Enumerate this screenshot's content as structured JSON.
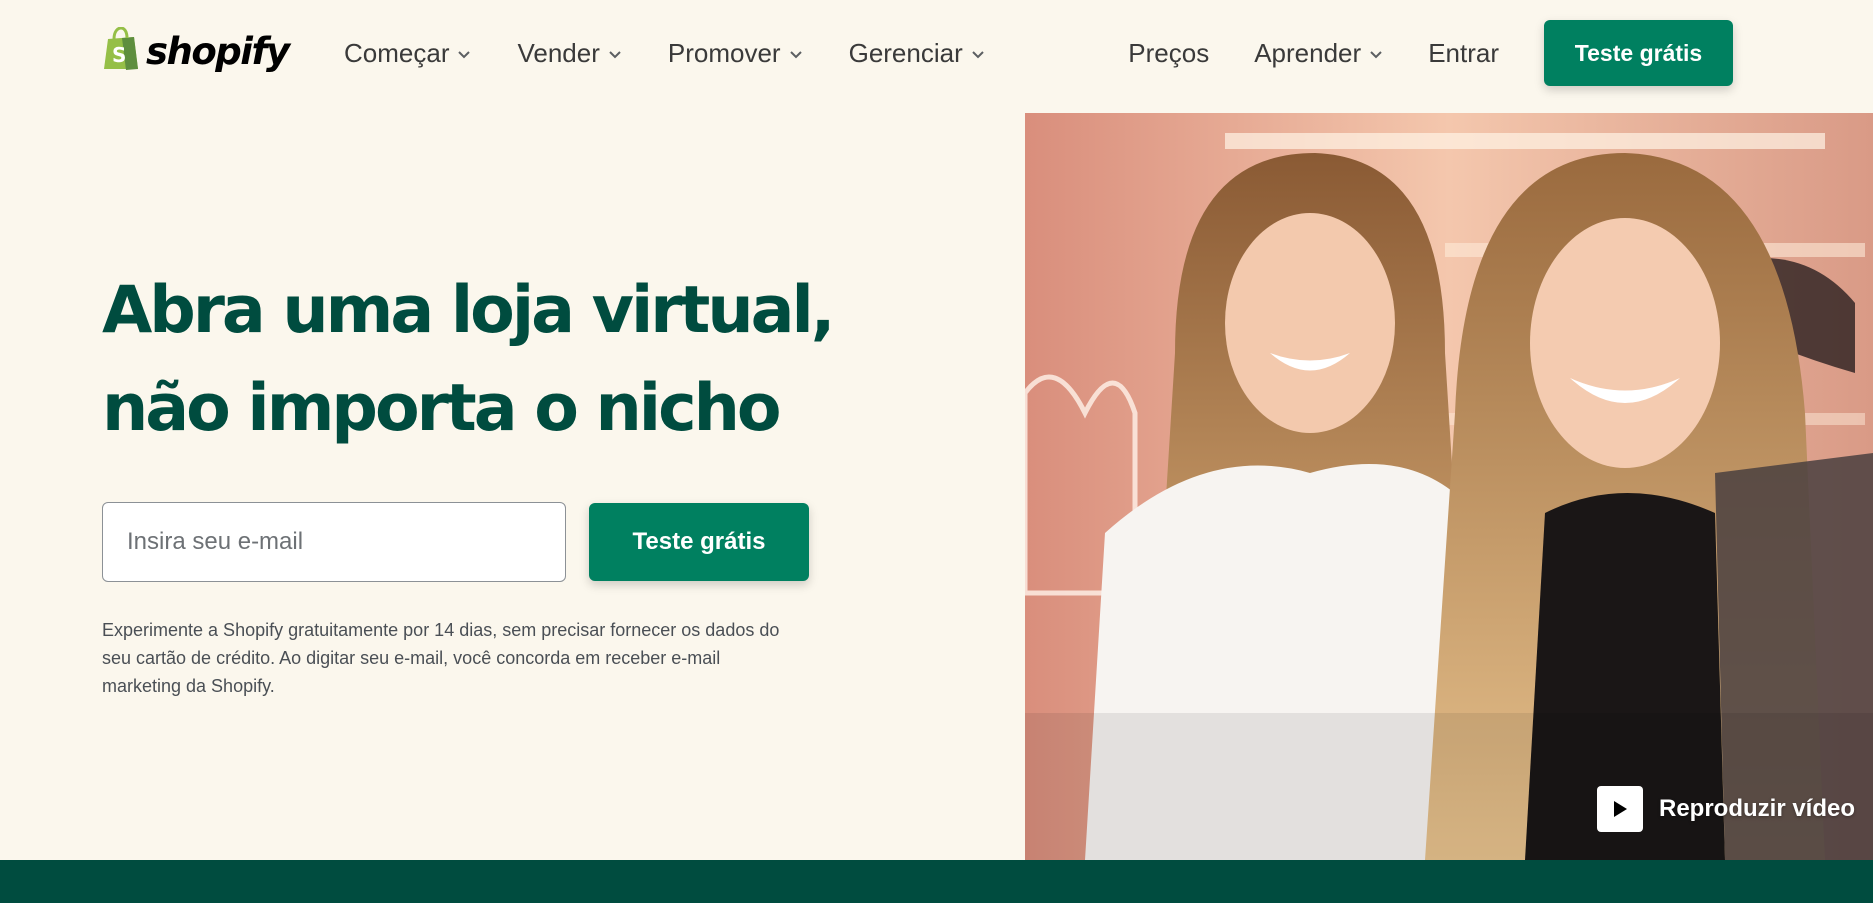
{
  "header": {
    "logo_text": "shopify",
    "nav_left": [
      {
        "label": "Começar",
        "has_dropdown": true
      },
      {
        "label": "Vender",
        "has_dropdown": true
      },
      {
        "label": "Promover",
        "has_dropdown": true
      },
      {
        "label": "Gerenciar",
        "has_dropdown": true
      }
    ],
    "nav_right": [
      {
        "label": "Preços",
        "has_dropdown": false
      },
      {
        "label": "Aprender",
        "has_dropdown": true
      },
      {
        "label": "Entrar",
        "has_dropdown": false
      }
    ],
    "cta_label": "Teste grátis"
  },
  "hero": {
    "headline_line1": "Abra uma loja virtual,",
    "headline_line2": "não importa o nicho",
    "email_placeholder": "Insira seu e-mail",
    "email_value": "",
    "cta_label": "Teste grátis",
    "disclaimer_line1": "Experimente a Shopify gratuitamente por 14 dias, sem precisar fornecer os dados do",
    "disclaimer_line2": "seu cartão de crédito. Ao digitar seu e-mail, você concorda em receber e-mail",
    "disclaimer_line3": "marketing da Shopify.",
    "video_label": "Reproduzir vídeo"
  },
  "icons": {
    "logo": "shopify-bag-icon",
    "dropdown": "chevron-down-icon",
    "play": "play-icon"
  },
  "colors": {
    "background": "#fbf7ed",
    "brand_green": "#008060",
    "headline": "#004c3f",
    "footer_band": "#004c3f",
    "logo_green": "#95bf47"
  }
}
